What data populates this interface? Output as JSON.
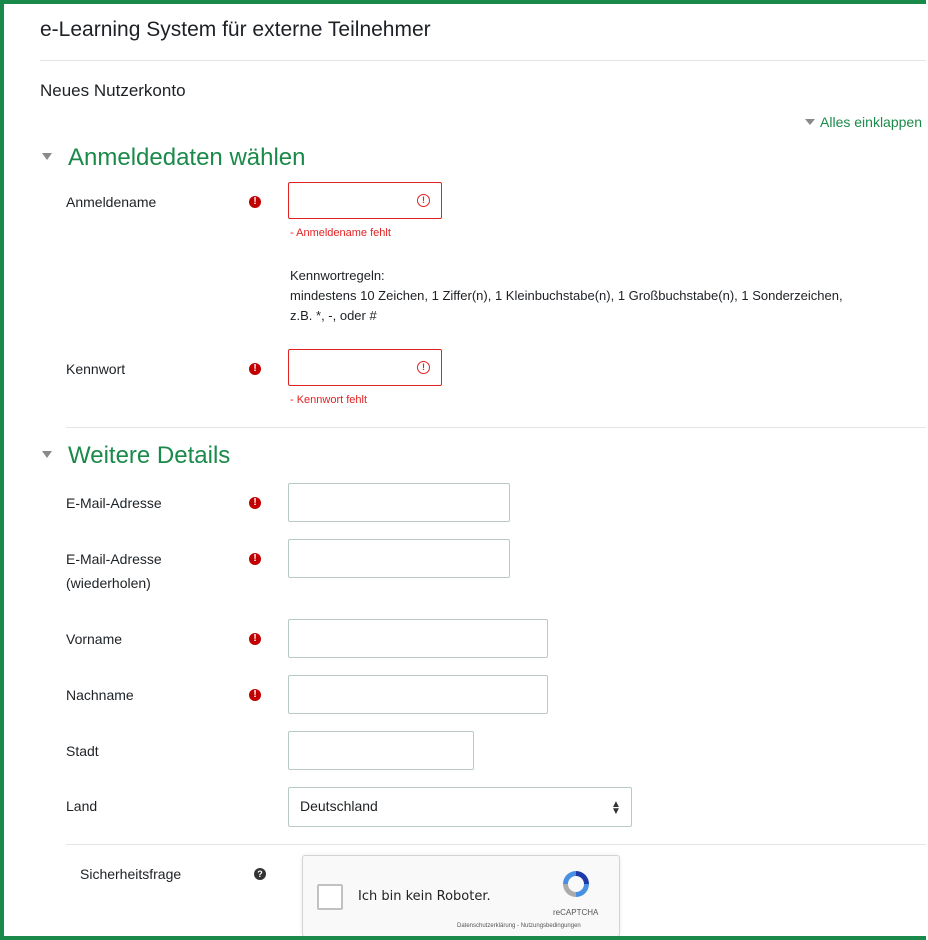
{
  "site": {
    "title": "e-Learning System für externe Teilnehmer"
  },
  "page": {
    "title": "Neues Nutzerkonto",
    "collapse_all": "Alles einklappen"
  },
  "sections": {
    "login": {
      "title": "Anmeldedaten wählen"
    },
    "details": {
      "title": "Weitere Details"
    }
  },
  "fields": {
    "username": {
      "label": "Anmeldename",
      "value": "",
      "error": "- Anmeldename fehlt"
    },
    "password_rules": {
      "title": "Kennwortregeln:",
      "line1": "mindestens 10 Zeichen, 1 Ziffer(n), 1 Kleinbuchstabe(n), 1 Großbuchstabe(n), 1 Sonderzeichen,",
      "line2": "z.B. *, -, oder #"
    },
    "password": {
      "label": "Kennwort",
      "value": "",
      "error": "- Kennwort fehlt"
    },
    "email": {
      "label": "E-Mail-Adresse",
      "value": ""
    },
    "email2": {
      "label_line1": "E-Mail-Adresse",
      "label_line2": "(wiederholen)",
      "value": ""
    },
    "firstname": {
      "label": "Vorname",
      "value": ""
    },
    "lastname": {
      "label": "Nachname",
      "value": ""
    },
    "city": {
      "label": "Stadt",
      "value": ""
    },
    "country": {
      "label": "Land",
      "selected": "Deutschland"
    },
    "captcha": {
      "label": "Sicherheitsfrage"
    }
  },
  "recaptcha": {
    "checkbox_label": "Ich bin kein Roboter.",
    "brand": "reCAPTCHA",
    "links": "Datenschutzerklärung - Nutzungsbedingungen"
  },
  "icons": {
    "required": "exclamation-circle-icon",
    "invalid": "exclamation-circle-outline-icon",
    "help": "question-circle-icon",
    "collapse": "triangle-down-icon"
  },
  "colors": {
    "accent": "#1a8a4a",
    "error": "#e32222",
    "required": "#c30000"
  }
}
